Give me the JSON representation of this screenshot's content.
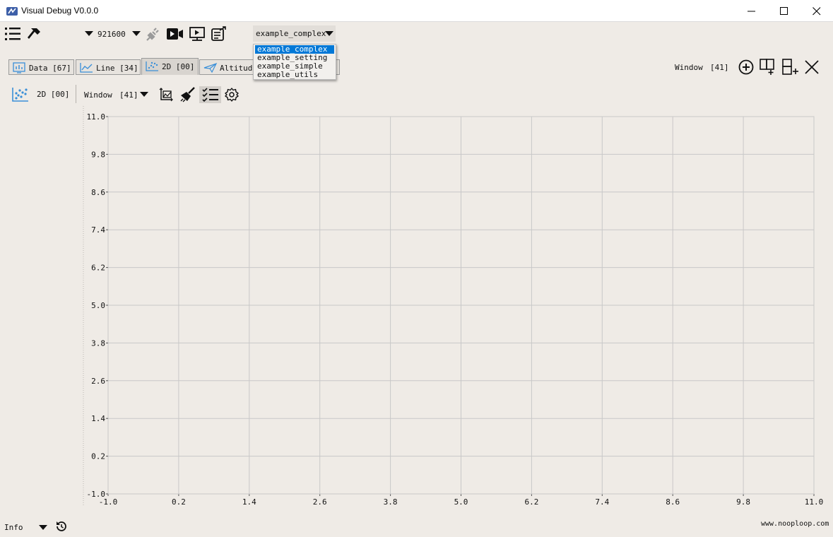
{
  "window": {
    "title": "Visual Debug V0.0.0"
  },
  "toolbar": {
    "baud_rate": "921600",
    "script_combo": {
      "selected": "example_complex",
      "options": [
        "example_complex",
        "example_setting",
        "example_simple",
        "example_utils"
      ]
    }
  },
  "tabs": [
    {
      "label": "Data [67]",
      "icon": "data-icon",
      "active": false
    },
    {
      "label": "Line [34]",
      "icon": "line-chart-icon",
      "active": false
    },
    {
      "label": "2D [00]",
      "icon": "scatter-icon",
      "active": true
    },
    {
      "label": "Altitude",
      "icon": "plane-icon",
      "active": false
    }
  ],
  "tab_bar_right": {
    "window_label": "Window",
    "window_value": "[41]"
  },
  "chart_toolbar": {
    "label": "2D [00]",
    "window_label": "Window",
    "window_value": "[41]"
  },
  "chart_data": {
    "type": "scatter",
    "series": [],
    "x": {
      "min": -1.0,
      "max": 11.0,
      "ticks": [
        "-1.0",
        "0.2",
        "1.4",
        "2.6",
        "3.8",
        "5.0",
        "6.2",
        "7.4",
        "8.6",
        "9.8",
        "11.0"
      ]
    },
    "y": {
      "min": -1.0,
      "max": 11.0,
      "ticks": [
        "-1.0",
        "0.2",
        "1.4",
        "2.6",
        "3.8",
        "5.0",
        "6.2",
        "7.4",
        "8.6",
        "9.8",
        "11.0"
      ]
    },
    "grid": true,
    "colors": {
      "grid": "#c8c8c8",
      "background": "#efebe6"
    }
  },
  "statusbar": {
    "log_level": "Info",
    "website": "www.nooploop.com"
  },
  "colors": {
    "accent": "#0078d7",
    "icon_blue": "#3a8fd8"
  }
}
